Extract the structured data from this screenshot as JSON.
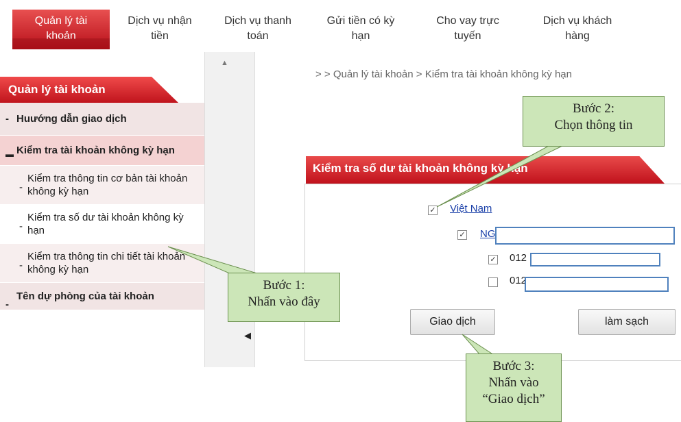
{
  "nav": {
    "tabs": [
      {
        "line1": "Quản lý tài",
        "line2": "khoản"
      },
      {
        "line1": "Dịch vụ nhận",
        "line2": "tiền"
      },
      {
        "line1": "Dịch vụ thanh",
        "line2": "toán"
      },
      {
        "line1": "Gửi tiền có kỳ",
        "line2": "hạn"
      },
      {
        "line1": "Cho vay trực",
        "line2": "tuyến"
      },
      {
        "line1": "Dịch vụ khách",
        "line2": "hàng"
      }
    ]
  },
  "sidebar": {
    "title": "Quản lý tài khoản",
    "items": [
      {
        "label": "Huướng dẫn giao dịch"
      },
      {
        "label": "Kiểm tra tài khoản không kỳ hạn"
      },
      {
        "label": "Kiểm tra thông tin cơ bản tài khoản không kỳ hạn"
      },
      {
        "label": "Kiểm tra số dư tài khoản không kỳ hạn"
      },
      {
        "label": "Kiểm tra thông tin chi tiết tài khoản không kỳ hạn"
      },
      {
        "label": "Tên dự phòng của tài khoản"
      }
    ]
  },
  "breadcrumb": "> > Quản lý tài khoản > Kiểm tra tài khoản không kỳ hạn",
  "panel": {
    "title": "Kiểm tra số dư tài khoản không kỳ hạn",
    "tree": {
      "country": {
        "label": "Việt Nam",
        "checked": true
      },
      "holder": {
        "label": "NG",
        "checked": true
      },
      "accounts": [
        {
          "label": "012",
          "checked": true
        },
        {
          "label": "012",
          "checked": false
        }
      ]
    },
    "buttons": {
      "transact": "Giao dịch",
      "clear": "làm sạch"
    }
  },
  "callouts": {
    "step1": {
      "line1": "Bước 1:",
      "line2": "Nhấn vào đây"
    },
    "step2": {
      "line1": "Bước 2:",
      "line2": "Chọn thông tin"
    },
    "step3": {
      "line1": "Bước 3:",
      "line2": "Nhấn vào",
      "line3": "“Giao dịch”"
    }
  },
  "colors": {
    "brand_red": "#c1121c",
    "callout_green": "#cce6b8",
    "link_blue": "#1a3fa8"
  }
}
